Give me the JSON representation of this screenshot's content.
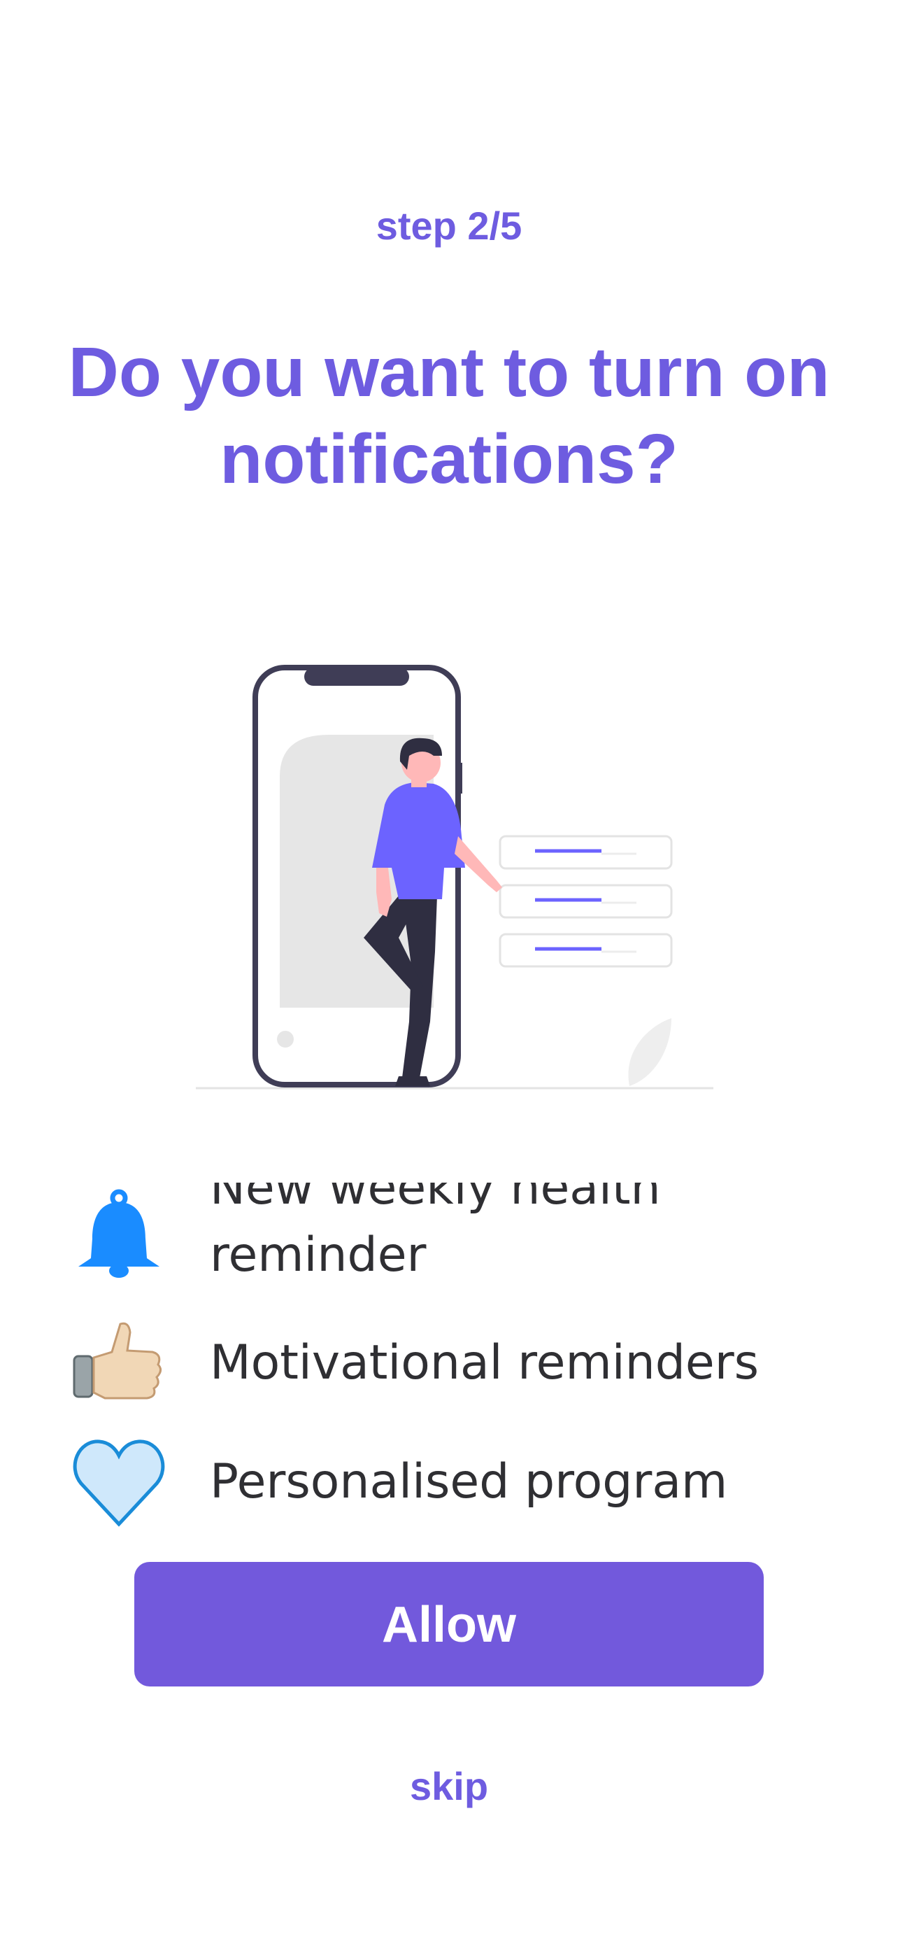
{
  "header": {
    "step_label": "step 2/5",
    "title": "Do you want to turn on notifications?"
  },
  "features": [
    {
      "icon": "bell-icon",
      "label": "New weekly health reminder"
    },
    {
      "icon": "thumbs-up-icon",
      "label": "Motivational reminders"
    },
    {
      "icon": "heart-icon",
      "label": "Personalised program"
    }
  ],
  "actions": {
    "allow_label": "Allow",
    "skip_label": "skip"
  },
  "colors": {
    "accent": "#6e5ce0",
    "button": "#7259dc",
    "text": "#2f2f33",
    "bell": "#1a8cff",
    "heart": "#cfe8fb"
  }
}
